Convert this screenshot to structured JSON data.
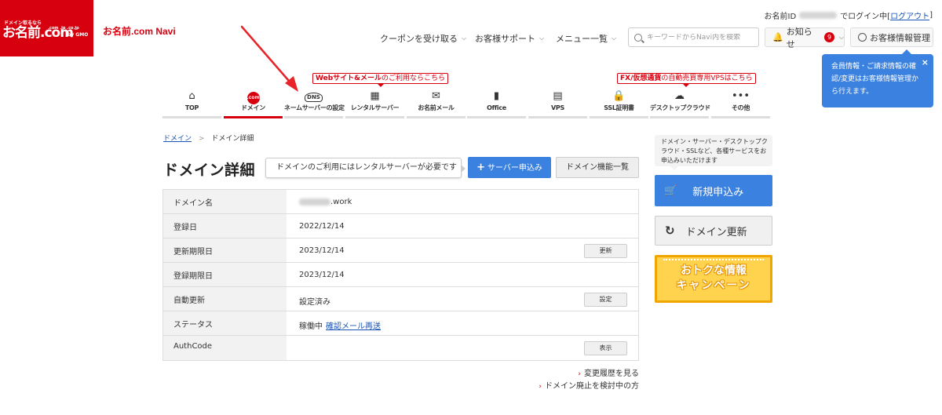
{
  "header": {
    "logo_tag": "ドメイン取るなら",
    "logo_main": "お名前.com",
    "logo_sub": ".com .jp .co.jp",
    "logo_gmo": "by GMO",
    "navi_title": "お名前.com Navi",
    "login_prefix": "お名前ID",
    "login_suffix": "でログイン中[",
    "logout_label": "ログアウト",
    "login_close": "]",
    "nav": [
      {
        "label": "クーポンを受け取る"
      },
      {
        "label": "お客様サポート"
      },
      {
        "label": "メニュー一覧"
      }
    ],
    "search_placeholder": "キーワードからNavi内を検索",
    "notice_label": "お知らせ",
    "notice_count": "9",
    "account_label": "お客様情報管理",
    "tooltip_text": "会員情報・ご請求情報の確認/変更はお客様情報管理から行えます。",
    "tooltip_close": "×"
  },
  "categories": {
    "notice_web_bold": "Webサイト&メール",
    "notice_web_rest": "のご利用ならこちら",
    "notice_fx_bold": "FX/仮想通貨",
    "notice_fx_rest": "の自動売買専用VPSはこちら",
    "items": [
      {
        "label": "TOP"
      },
      {
        "label": "ドメイン",
        "icon": ".com"
      },
      {
        "label": "ネームサーバーの設定",
        "icon": "DNS"
      },
      {
        "label": "レンタルサーバー"
      },
      {
        "label": "お名前メール"
      },
      {
        "label": "Office"
      },
      {
        "label": "VPS"
      },
      {
        "label": "SSL証明書"
      },
      {
        "label": "デスクトップクラウド"
      },
      {
        "label": "その他"
      }
    ]
  },
  "breadcrumb": {
    "root": "ドメイン",
    "sep": ">",
    "current": "ドメイン詳細"
  },
  "main": {
    "title": "ドメイン詳細",
    "callout": "ドメインのご利用にはレンタルサーバーが必要です",
    "server_button": "サーバー申込み",
    "features_button": "ドメイン機能一覧",
    "rows": [
      {
        "label": "ドメイン名",
        "value": ".work"
      },
      {
        "label": "登録日",
        "value": "2022/12/14"
      },
      {
        "label": "更新期限日",
        "value": "2023/12/14",
        "button": "更新"
      },
      {
        "label": "登録期限日",
        "value": "2023/12/14"
      },
      {
        "label": "自動更新",
        "value": "設定済み",
        "button": "設定"
      },
      {
        "label": "ステータス",
        "value": "稼働中",
        "link": "確認メール再送"
      },
      {
        "label": "AuthCode",
        "value": "",
        "button": "表示"
      }
    ],
    "links": [
      {
        "label": "変更履歴を見る"
      },
      {
        "label": "ドメイン廃止を検討中の方"
      }
    ]
  },
  "sidebar": {
    "callout": "ドメイン・サーバー・デスクトップクラウド・SSLなど、各種サービスをお申込みいただけます",
    "new_button": "新規申込み",
    "renew_button": "ドメイン更新",
    "campaign_line1": "おトクな情報",
    "campaign_line2": "キャンペーン"
  },
  "colors": {
    "brand_red": "#d7000f",
    "accent_blue": "#3b82e0",
    "campaign_yellow": "#ffd34d"
  }
}
